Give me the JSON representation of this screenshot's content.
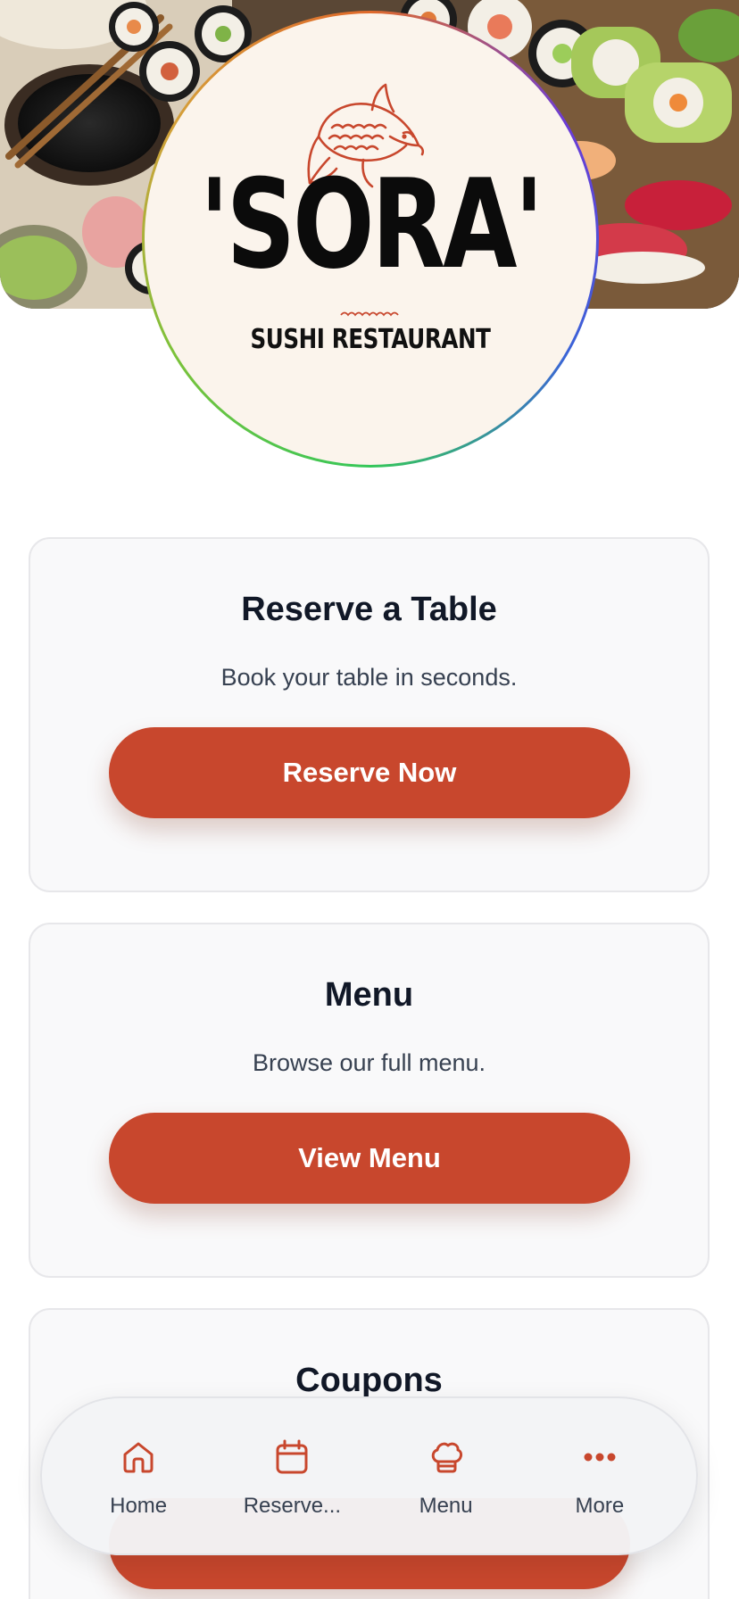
{
  "logo": {
    "name": "'SORA'",
    "tagline": "SUSHI RESTAURANT"
  },
  "cards": [
    {
      "title": "Reserve a Table",
      "description": "Book your table in seconds.",
      "button": "Reserve Now"
    },
    {
      "title": "Menu",
      "description": "Browse our full menu.",
      "button": "View Menu"
    },
    {
      "title": "Coupons",
      "description": "",
      "button": ""
    }
  ],
  "bottom_nav": {
    "items": [
      {
        "label": "Home",
        "icon": "home-icon"
      },
      {
        "label": "Reserve...",
        "icon": "calendar-icon"
      },
      {
        "label": "Menu",
        "icon": "chef-hat-icon"
      },
      {
        "label": "More",
        "icon": "more-dots-icon"
      }
    ]
  },
  "colors": {
    "accent": "#c8472d",
    "card_background": "#f9f9fa",
    "logo_background": "#fbf4ec",
    "heading": "#111827"
  }
}
